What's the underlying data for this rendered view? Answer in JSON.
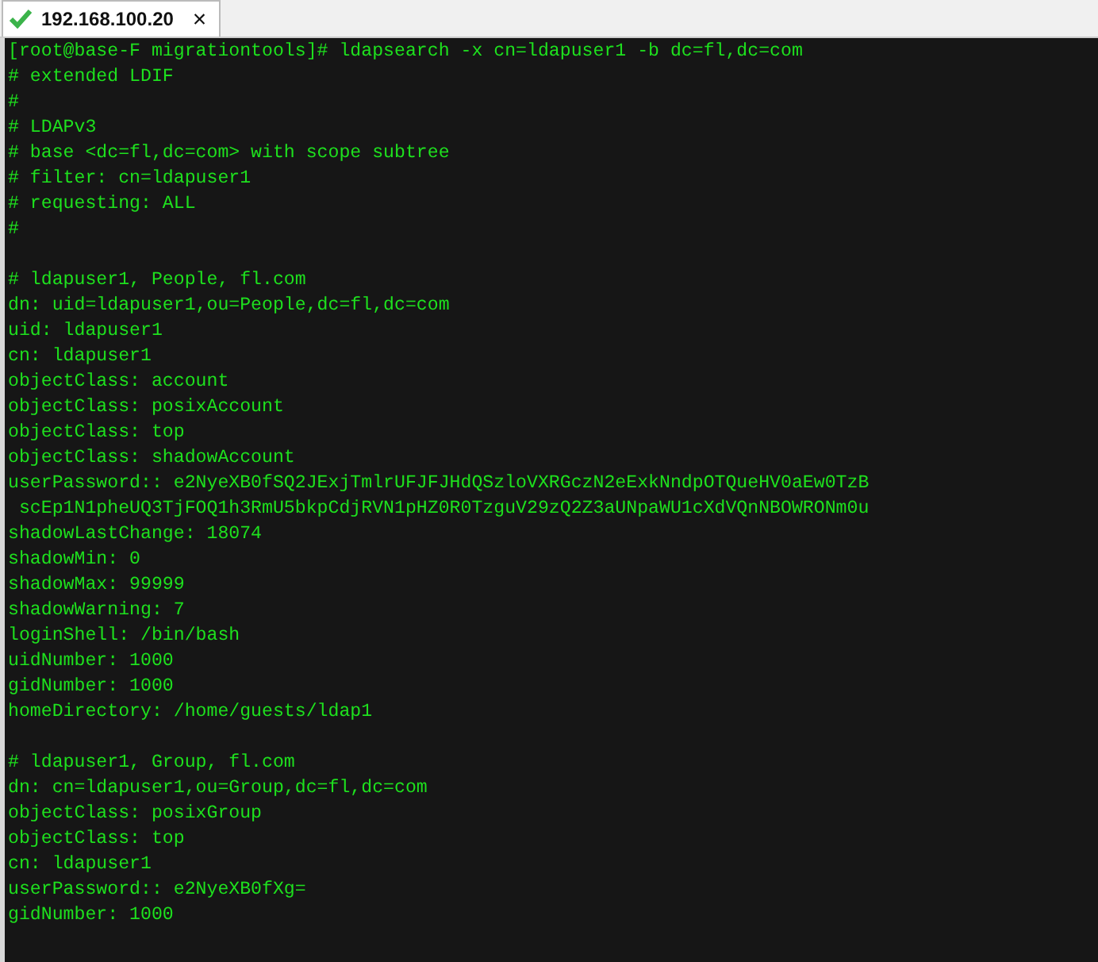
{
  "tab": {
    "label": "192.168.100.20",
    "close": "×"
  },
  "terminal": {
    "blocks": [
      [
        "[root@base-F migrationtools]# ldapsearch -x cn=ldapuser1 -b dc=fl,dc=com",
        "# extended LDIF",
        "#",
        "# LDAPv3",
        "# base <dc=fl,dc=com> with scope subtree",
        "# filter: cn=ldapuser1",
        "# requesting: ALL",
        "#"
      ],
      [
        "# ldapuser1, People, fl.com",
        "dn: uid=ldapuser1,ou=People,dc=fl,dc=com",
        "uid: ldapuser1",
        "cn: ldapuser1",
        "objectClass: account",
        "objectClass: posixAccount",
        "objectClass: top",
        "objectClass: shadowAccount",
        "userPassword:: e2NyeXB0fSQ2JExjTmlrUFJFJHdQSzloVXRGczN2eExkNndpOTQueHV0aEw0TzB",
        " scEp1N1pheUQ3TjFOQ1h3RmU5bkpCdjRVN1pHZ0R0TzguV29zQ2Z3aUNpaWU1cXdVQnNBOWRONm0u",
        "shadowLastChange: 18074",
        "shadowMin: 0",
        "shadowMax: 99999",
        "shadowWarning: 7",
        "loginShell: /bin/bash",
        "uidNumber: 1000",
        "gidNumber: 1000",
        "homeDirectory: /home/guests/ldap1"
      ],
      [
        "# ldapuser1, Group, fl.com",
        "dn: cn=ldapuser1,ou=Group,dc=fl,dc=com",
        "objectClass: posixGroup",
        "objectClass: top",
        "cn: ldapuser1",
        "userPassword:: e2NyeXB0fXg=",
        "gidNumber: 1000"
      ]
    ]
  }
}
